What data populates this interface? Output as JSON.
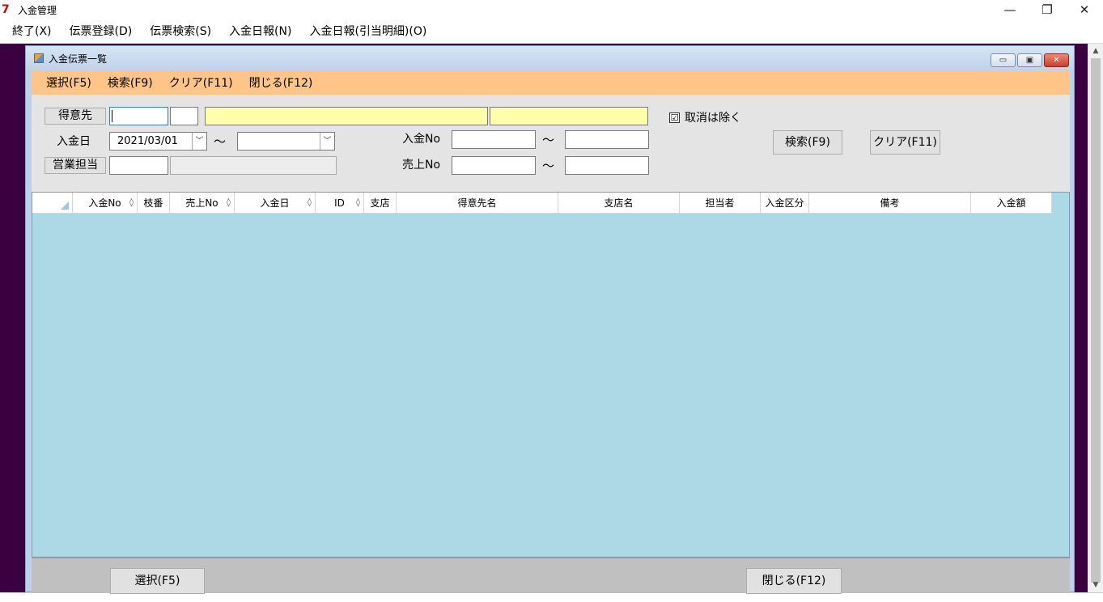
{
  "app": {
    "title": "入金管理",
    "icon_glyph": "7",
    "controls": {
      "minimize": "—",
      "restore": "❐",
      "close": "✕"
    }
  },
  "app_menu": [
    {
      "label": "終了(X)"
    },
    {
      "label": "伝票登録(D)"
    },
    {
      "label": "伝票検索(S)"
    },
    {
      "label": "入金日報(N)"
    },
    {
      "label": "入金日報(引当明細)(O)"
    }
  ],
  "child": {
    "title": "入金伝票一覧",
    "controls": {
      "minimize": "▭",
      "restore": "▣",
      "close": "✕"
    },
    "menu": [
      {
        "label": "選択(F5)"
      },
      {
        "label": "検索(F9)"
      },
      {
        "label": "クリア(F11)"
      },
      {
        "label": "閉じる(F12)"
      }
    ]
  },
  "search": {
    "customer_button": "得意先",
    "deposit_date_label": "入金日",
    "deposit_date_from": "2021/03/01",
    "deposit_date_to": "",
    "tilde": "～",
    "sales_staff_button": "営業担当",
    "deposit_no_label": "入金No",
    "sales_no_label": "売上No",
    "exclude_cancel_label": "取消は除く",
    "exclude_cancel_checked": "☑",
    "search_button": "検索(F9)",
    "clear_button": "クリア(F11)"
  },
  "grid": {
    "columns": [
      {
        "label": "入金No",
        "sortable": "◊"
      },
      {
        "label": "枝番"
      },
      {
        "label": "売上No",
        "sortable": "◊"
      },
      {
        "label": "入金日",
        "sortable": "◊"
      },
      {
        "label": "ID",
        "sortable": "◊"
      },
      {
        "label": "支店"
      },
      {
        "label": "得意先名"
      },
      {
        "label": "支店名"
      },
      {
        "label": "担当者"
      },
      {
        "label": "入金区分"
      },
      {
        "label": "備考"
      },
      {
        "label": "入金額"
      }
    ],
    "rows": []
  },
  "footer": {
    "select_button": "選択(F5)",
    "close_button": "閉じる(F12)"
  },
  "colors": {
    "mdi_background": "#3a0040",
    "child_menu": "#ffc487",
    "grid_background": "#add8e6",
    "yellow_field": "#ffffaa"
  }
}
